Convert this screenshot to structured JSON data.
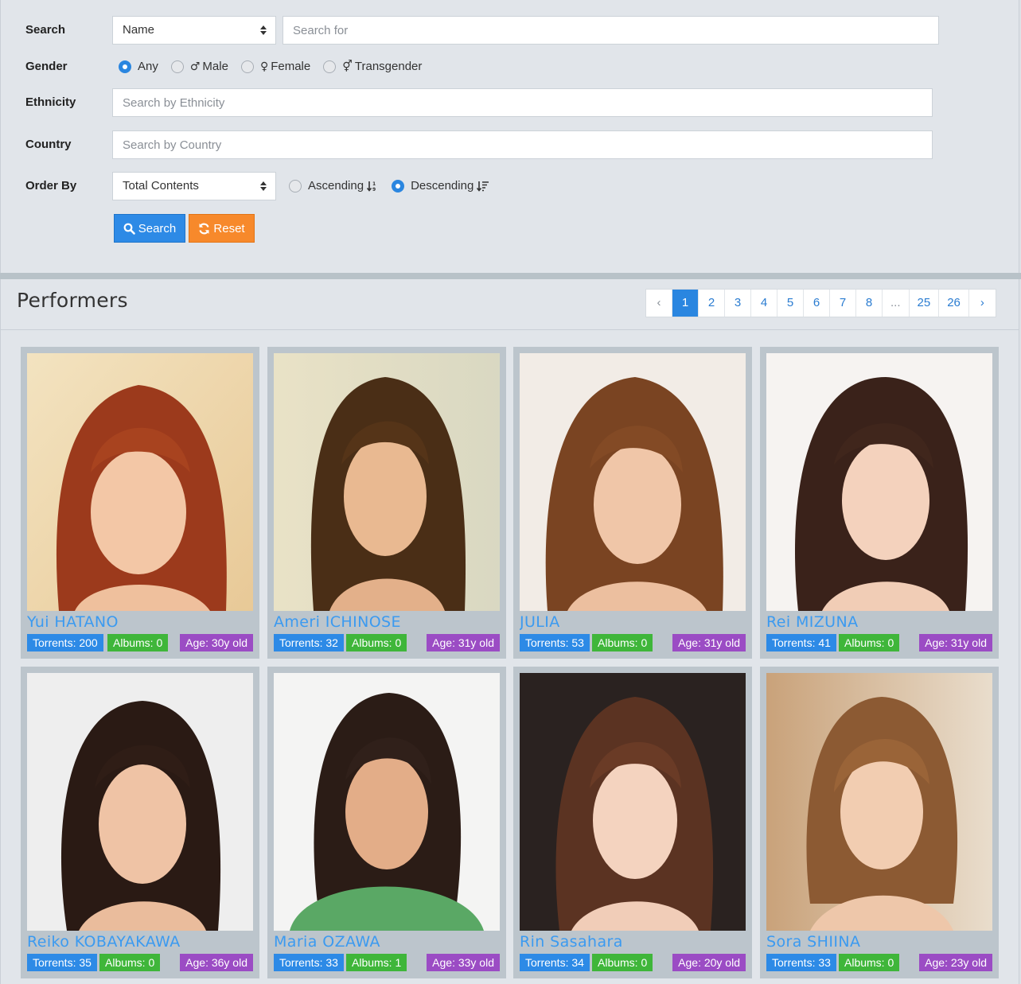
{
  "filters": {
    "search": {
      "label": "Search",
      "field_select": "Name",
      "placeholder": "Search for"
    },
    "gender": {
      "label": "Gender",
      "options": [
        {
          "label": "Any",
          "symbol": "",
          "checked": true
        },
        {
          "label": "Male",
          "symbol": "♂",
          "checked": false
        },
        {
          "label": "Female",
          "symbol": "♀",
          "checked": false
        },
        {
          "label": "Transgender",
          "symbol": "⚥",
          "checked": false
        }
      ]
    },
    "ethnicity": {
      "label": "Ethnicity",
      "placeholder": "Search by Ethnicity"
    },
    "country": {
      "label": "Country",
      "placeholder": "Search by Country"
    },
    "order_by": {
      "label": "Order By",
      "selected": "Total Contents",
      "ascending_label": "Ascending",
      "descending_label": "Descending",
      "descending_checked": true
    },
    "search_button": "Search",
    "reset_button": "Reset"
  },
  "performers": {
    "title": "Performers",
    "pagination": {
      "prev": "‹",
      "pages": [
        "1",
        "2",
        "3",
        "4",
        "5",
        "6",
        "7",
        "8",
        "...",
        "25",
        "26"
      ],
      "current": "1",
      "next": "›"
    },
    "cards": [
      {
        "name": "Yui HATANO",
        "torrents": "Torrents: 200",
        "albums": "Albums: 0",
        "age": "Age: 30y old"
      },
      {
        "name": "Ameri ICHINOSE",
        "torrents": "Torrents: 32",
        "albums": "Albums: 0",
        "age": "Age: 31y old"
      },
      {
        "name": "JULIA",
        "torrents": "Torrents: 53",
        "albums": "Albums: 0",
        "age": "Age: 31y old"
      },
      {
        "name": "Rei MIZUNA",
        "torrents": "Torrents: 41",
        "albums": "Albums: 0",
        "age": "Age: 31y old"
      },
      {
        "name": "Reiko KOBAYAKAWA",
        "torrents": "Torrents: 35",
        "albums": "Albums: 0",
        "age": "Age: 36y old"
      },
      {
        "name": "Maria OZAWA",
        "torrents": "Torrents: 33",
        "albums": "Albums: 1",
        "age": "Age: 33y old"
      },
      {
        "name": "Rin Sasahara",
        "torrents": "Torrents: 34",
        "albums": "Albums: 0",
        "age": "Age: 20y old"
      },
      {
        "name": "Sora SHIINA",
        "torrents": "Torrents: 33",
        "albums": "Albums: 0",
        "age": "Age: 23y old"
      }
    ]
  },
  "colors": {
    "accent_blue": "#2d8ae6",
    "reset_orange": "#f7892b",
    "albums_green": "#3fb63a",
    "age_purple": "#9b4cc4",
    "name_link": "#3b9af0"
  }
}
